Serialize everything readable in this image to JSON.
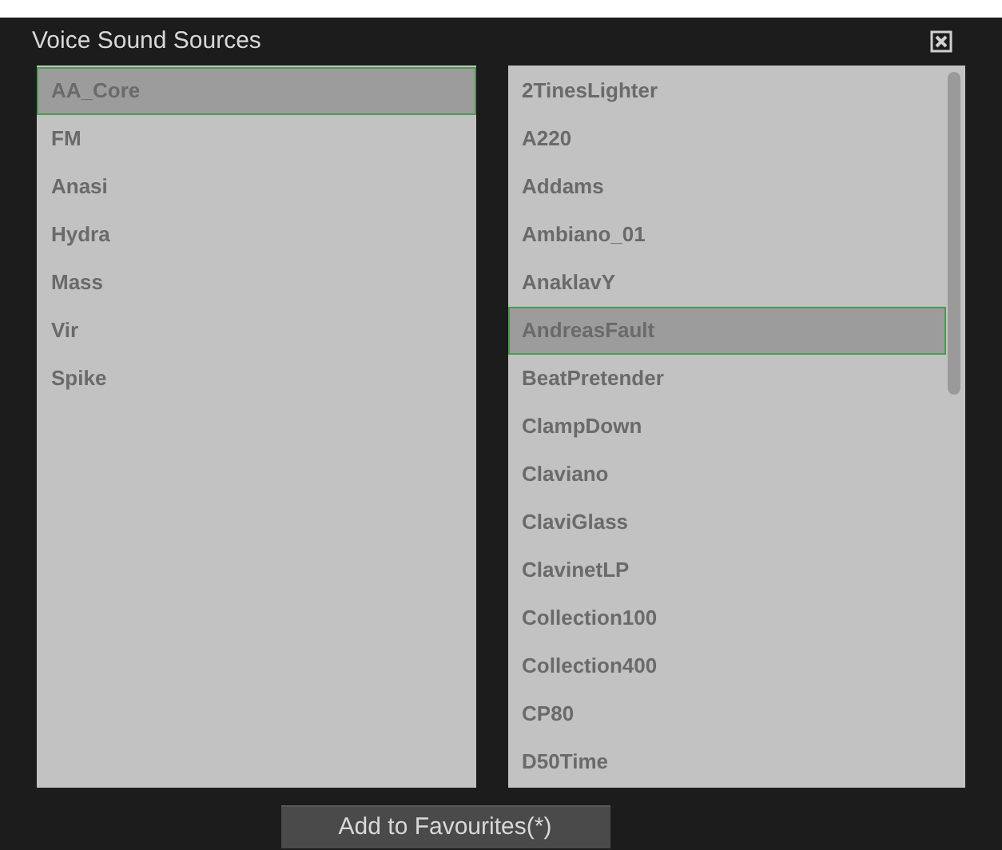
{
  "window": {
    "title": "Voice Sound Sources"
  },
  "sources": [
    {
      "label": "AA_Core",
      "selected": true
    },
    {
      "label": "FM",
      "selected": false
    },
    {
      "label": "Anasi",
      "selected": false
    },
    {
      "label": "Hydra",
      "selected": false
    },
    {
      "label": "Mass",
      "selected": false
    },
    {
      "label": "Vir",
      "selected": false
    },
    {
      "label": "Spike",
      "selected": false
    }
  ],
  "sounds": [
    {
      "label": "2TinesLighter",
      "selected": false
    },
    {
      "label": "A220",
      "selected": false
    },
    {
      "label": "Addams",
      "selected": false
    },
    {
      "label": "Ambiano_01",
      "selected": false
    },
    {
      "label": "AnaklavY",
      "selected": false
    },
    {
      "label": "AndreasFault",
      "selected": true
    },
    {
      "label": "BeatPretender",
      "selected": false
    },
    {
      "label": "ClampDown",
      "selected": false
    },
    {
      "label": "Claviano",
      "selected": false
    },
    {
      "label": "ClaviGlass",
      "selected": false
    },
    {
      "label": "ClavinetLP",
      "selected": false
    },
    {
      "label": "Collection100",
      "selected": false
    },
    {
      "label": "Collection400",
      "selected": false
    },
    {
      "label": "CP80",
      "selected": false
    },
    {
      "label": "D50Time",
      "selected": false
    }
  ],
  "button": {
    "label": "Add to Favourites(*)"
  }
}
